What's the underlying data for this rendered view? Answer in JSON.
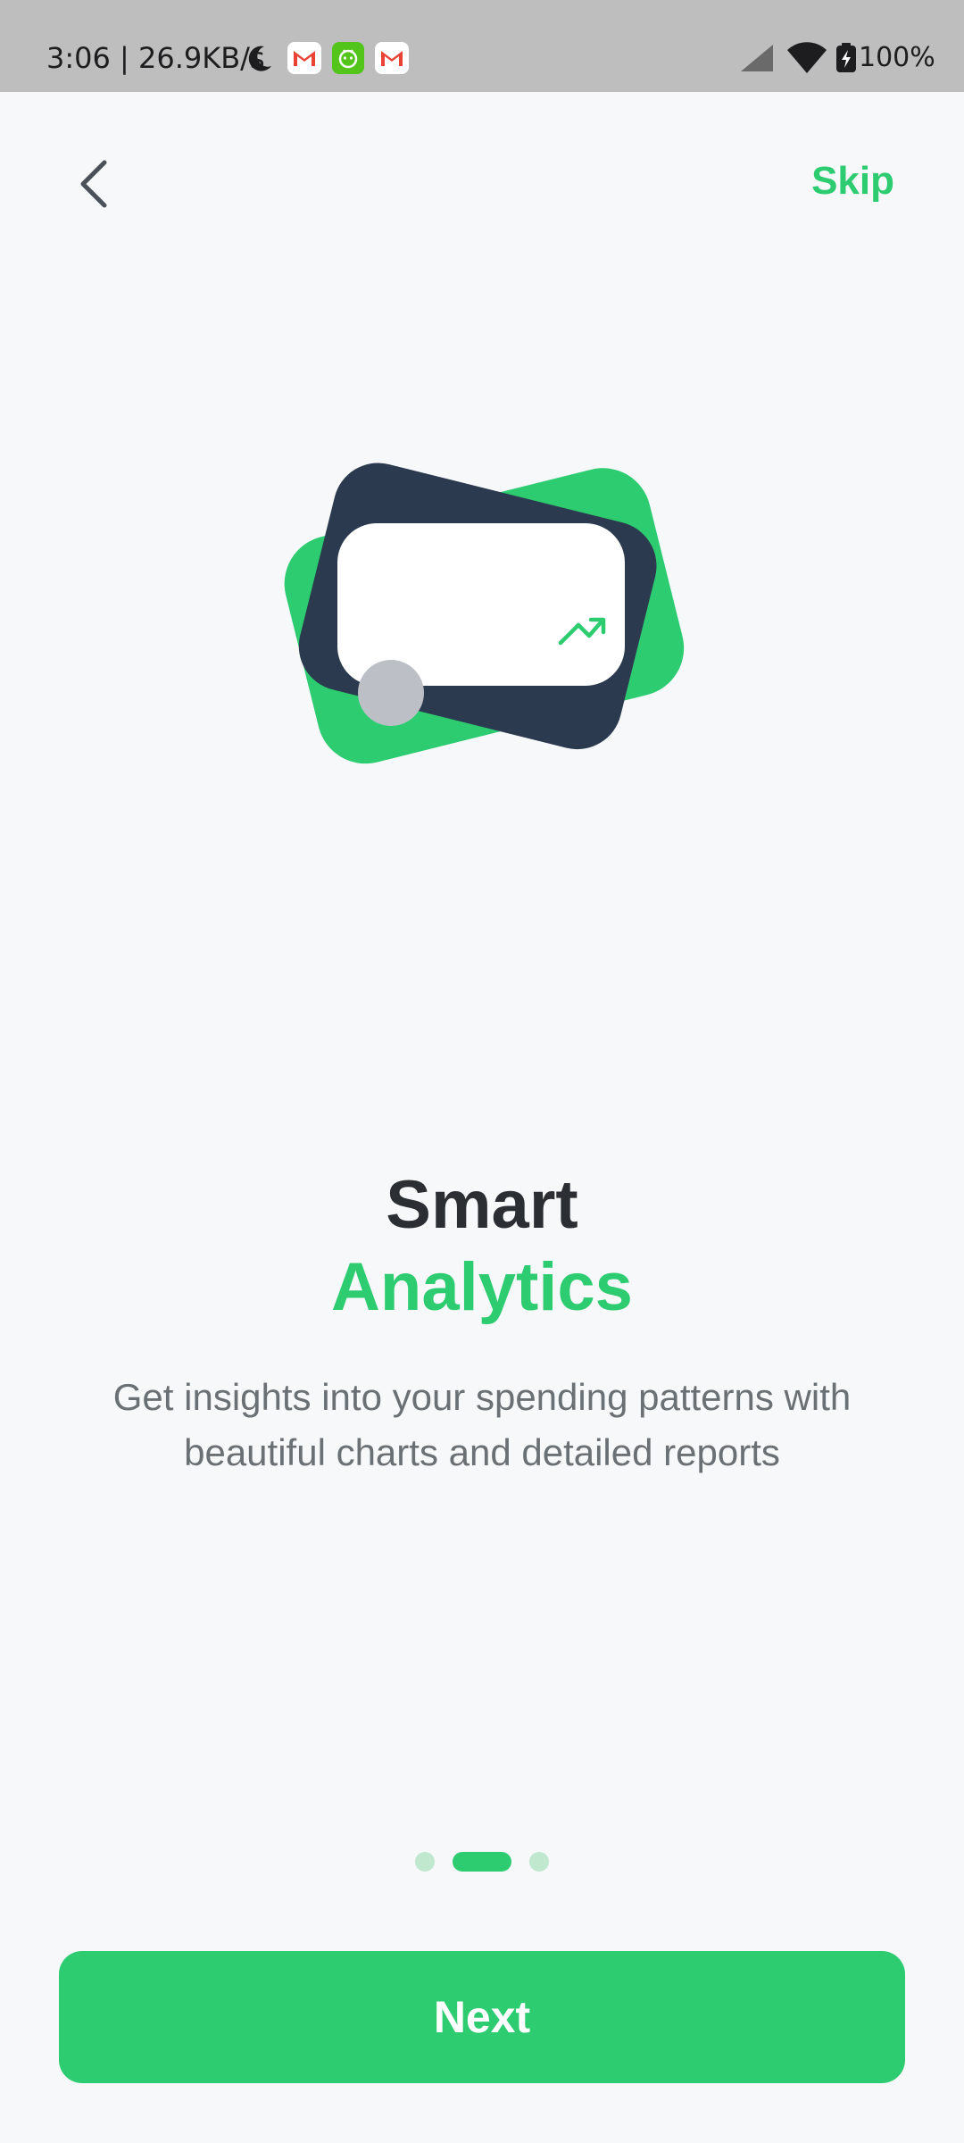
{
  "status_bar": {
    "time_speed": "3:06 | 26.9KB/s",
    "battery": "100%",
    "icons": [
      "moon-icon",
      "gmail-icon",
      "robot-app-icon",
      "gmail-icon",
      "signal-icon",
      "wifi-icon",
      "battery-charging-icon"
    ]
  },
  "nav": {
    "back_icon": "chevron-left-icon",
    "skip_label": "Skip"
  },
  "onboarding": {
    "title_line1": "Smart",
    "title_line2": "Analytics",
    "description": "Get insights into your spending patterns with beautiful charts and detailed reports",
    "page_index": 1,
    "page_count": 3
  },
  "next_label": "Next",
  "colors": {
    "accent": "#2ecc71",
    "dark": "#2b3a4e",
    "text_dark": "#2b2f33",
    "text_muted": "#6b7075",
    "background": "#f7f8fa",
    "status_bar": "#bdbebd"
  }
}
